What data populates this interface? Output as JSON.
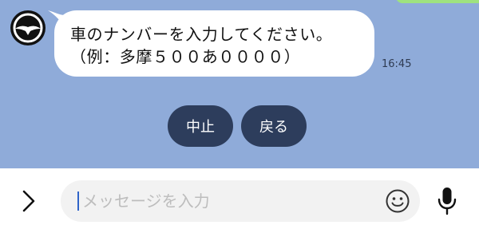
{
  "chat": {
    "message_lines": [
      "車のナンバーを入力してください。",
      "（例：多摩５００あ００００）"
    ],
    "timestamp": "16:45",
    "quick_replies": [
      {
        "label": "中止"
      },
      {
        "label": "戻る"
      }
    ]
  },
  "input_bar": {
    "placeholder": "メッセージを入力"
  },
  "icons": {
    "expand": "chevron-right-icon",
    "emoji": "smiley-icon",
    "mic": "microphone-icon",
    "avatar": "bird-logo-icon"
  },
  "colors": {
    "chat_background": "#8fabd9",
    "quick_reply_background": "#2d3d5c",
    "caret": "#2f64c9"
  }
}
